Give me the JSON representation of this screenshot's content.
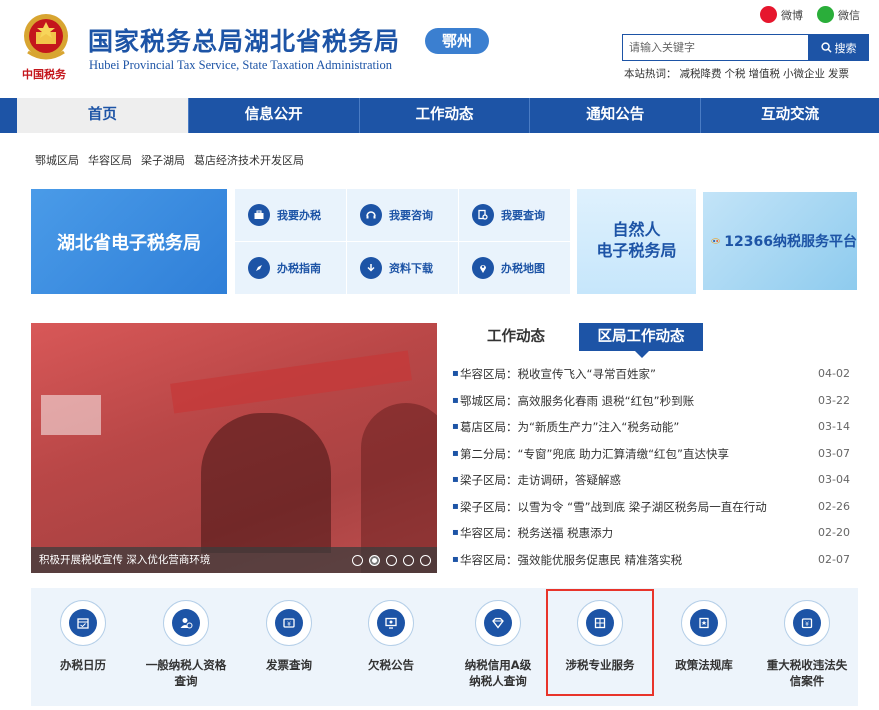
{
  "header": {
    "title": "国家税务总局湖北省税务局",
    "subtitle": "Hubei Provincial Tax Service, State Taxation Administration",
    "city_badge": "鄂州",
    "emblem_text": "中国税务",
    "share": {
      "weibo": "微博",
      "wechat": "微信"
    },
    "search": {
      "placeholder": "请输入关键字",
      "button": "搜索"
    },
    "hotwords_label": "本站热词：",
    "hotwords": [
      "减税降费",
      "个税",
      "增值税",
      "小微企业",
      "发票"
    ]
  },
  "nav": [
    "首页",
    "信息公开",
    "工作动态",
    "通知公告",
    "互动交流"
  ],
  "districts": [
    "鄂城区局",
    "华容区局",
    "梁子湖局",
    "葛店经济技术开发区局"
  ],
  "services": {
    "etax": "湖北省电子税务局",
    "quick": [
      {
        "label": "我要办税",
        "icon": "briefcase-icon"
      },
      {
        "label": "我要咨询",
        "icon": "headset-icon"
      },
      {
        "label": "我要查询",
        "icon": "search-doc-icon"
      },
      {
        "label": "办税指南",
        "icon": "compass-icon"
      },
      {
        "label": "资料下载",
        "icon": "download-icon"
      },
      {
        "label": "办税地图",
        "icon": "map-pin-icon"
      }
    ],
    "person_tax_line1": "自然人",
    "person_tax_line2": "电子税务局",
    "hotline": "12366纳税服务平台"
  },
  "slide": {
    "caption": "积极开展税收宣传 深入优化营商环境",
    "dots": 5,
    "active_dot": 1
  },
  "news": {
    "tabs": [
      "工作动态",
      "区局工作动态"
    ],
    "active_tab": 1,
    "items": [
      {
        "title": "华容区局：税收宣传飞入“寻常百姓家”",
        "date": "04-02"
      },
      {
        "title": "鄂城区局：高效服务化春雨 退税“红包”秒到账",
        "date": "03-22"
      },
      {
        "title": "葛店区局：为“新质生产力”注入“税务动能”",
        "date": "03-14"
      },
      {
        "title": "第二分局：“专窗”兜底 助力汇算清缴“红包”直达快享",
        "date": "03-07"
      },
      {
        "title": "梁子区局：走访调研，答疑解惑",
        "date": "03-04"
      },
      {
        "title": "梁子区局：以雪为令 “雪”战到底 梁子湖区税务局一直在行动",
        "date": "02-26"
      },
      {
        "title": "华容区局：税务送福 税惠添力",
        "date": "02-20"
      },
      {
        "title": "华容区局：强效能优服务促惠民 精准落实税",
        "date": "02-07"
      }
    ]
  },
  "bottom_services": [
    {
      "label": "办税日历",
      "icon": "calendar-icon"
    },
    {
      "label": "一般纳税人资格查询",
      "icon": "taxpayer-icon"
    },
    {
      "label": "发票查询",
      "icon": "invoice-icon"
    },
    {
      "label": "欠税公告",
      "icon": "monitor-icon"
    },
    {
      "label": "纳税信用A级纳税人查询",
      "icon": "diamond-icon"
    },
    {
      "label": "涉税专业服务",
      "icon": "calculator-icon"
    },
    {
      "label": "政策法规库",
      "icon": "book-icon"
    },
    {
      "label": "重大税收违法失信案件",
      "icon": "case-icon"
    }
  ],
  "colors": {
    "primary": "#1d54a6",
    "highlight": "#e8342a",
    "panel": "#edf4fb"
  }
}
